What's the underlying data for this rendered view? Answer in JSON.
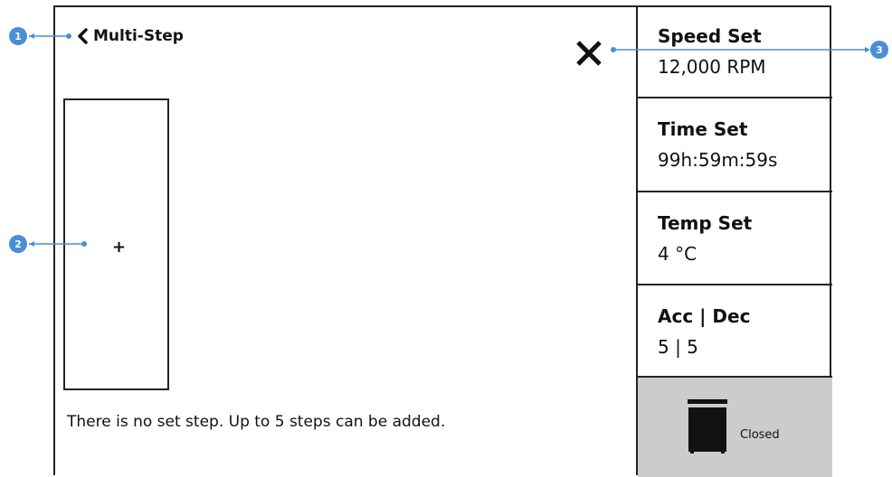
{
  "header": {
    "title": "Multi-Step"
  },
  "steps": {
    "add_symbol": "+",
    "empty_message": "There is no set step. Up to 5 steps can be added."
  },
  "settings": [
    {
      "label": "Speed Set",
      "value": "12,000 RPM"
    },
    {
      "label": "Time Set",
      "value": "99h:59m:59s"
    },
    {
      "label": "Temp Set",
      "value": "4 °C"
    },
    {
      "label": "Acc | Dec",
      "value": "5 | 5"
    }
  ],
  "door": {
    "status": "Closed",
    "icon": "door-closed-icon"
  },
  "annotations": [
    "1",
    "2",
    "3"
  ],
  "colors": {
    "accent": "#4a8fd6",
    "door_bg": "#cccccc",
    "border": "#222222"
  }
}
